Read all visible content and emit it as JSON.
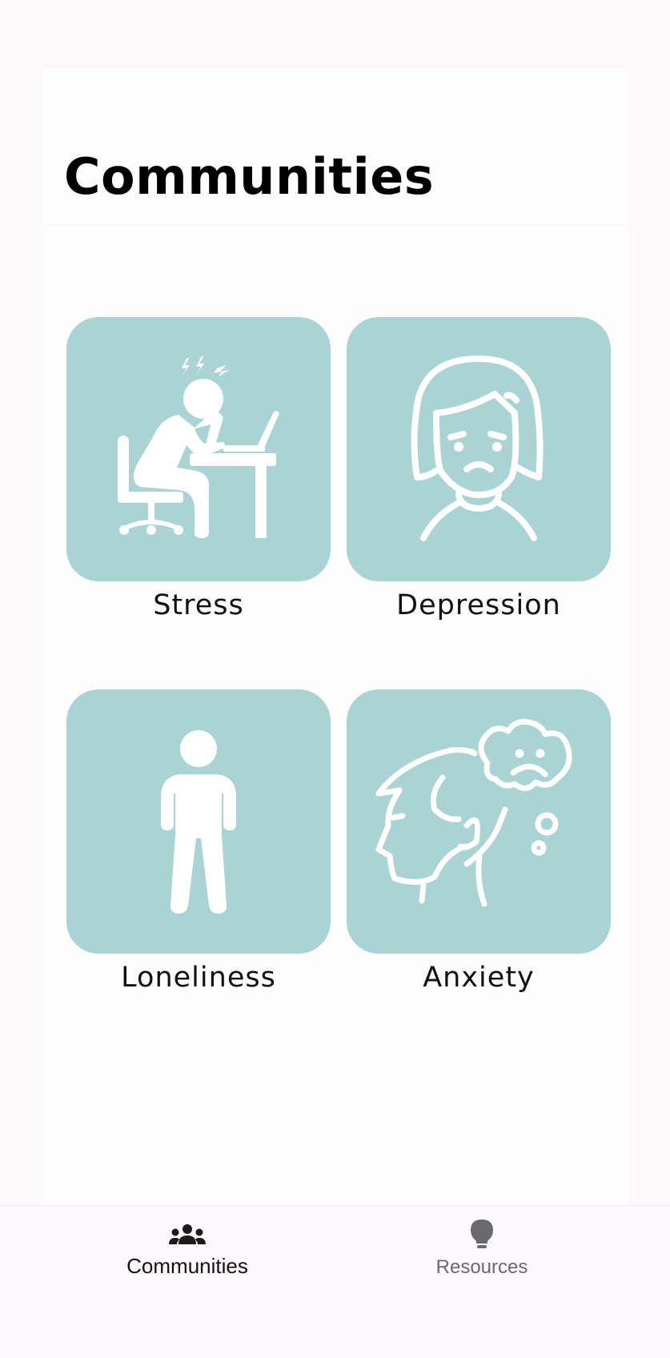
{
  "header": {
    "title": "Communities"
  },
  "communities": [
    {
      "label": "Stress",
      "icon": "stressed-at-desk-icon"
    },
    {
      "label": "Depression",
      "icon": "sad-face-icon"
    },
    {
      "label": "Loneliness",
      "icon": "lone-person-icon"
    },
    {
      "label": "Anxiety",
      "icon": "anxious-thought-icon"
    }
  ],
  "colors": {
    "tile_background": "#aad3d3",
    "icon_stroke": "#ffffff",
    "nav_background": "#fdf8fc",
    "nav_active_text": "#111111",
    "nav_inactive_text": "#6a6a6e"
  },
  "bottom_nav": {
    "items": [
      {
        "label": "Communities",
        "icon": "groups-icon",
        "active": true
      },
      {
        "label": "Resources",
        "icon": "lightbulb-icon",
        "active": false
      }
    ]
  }
}
